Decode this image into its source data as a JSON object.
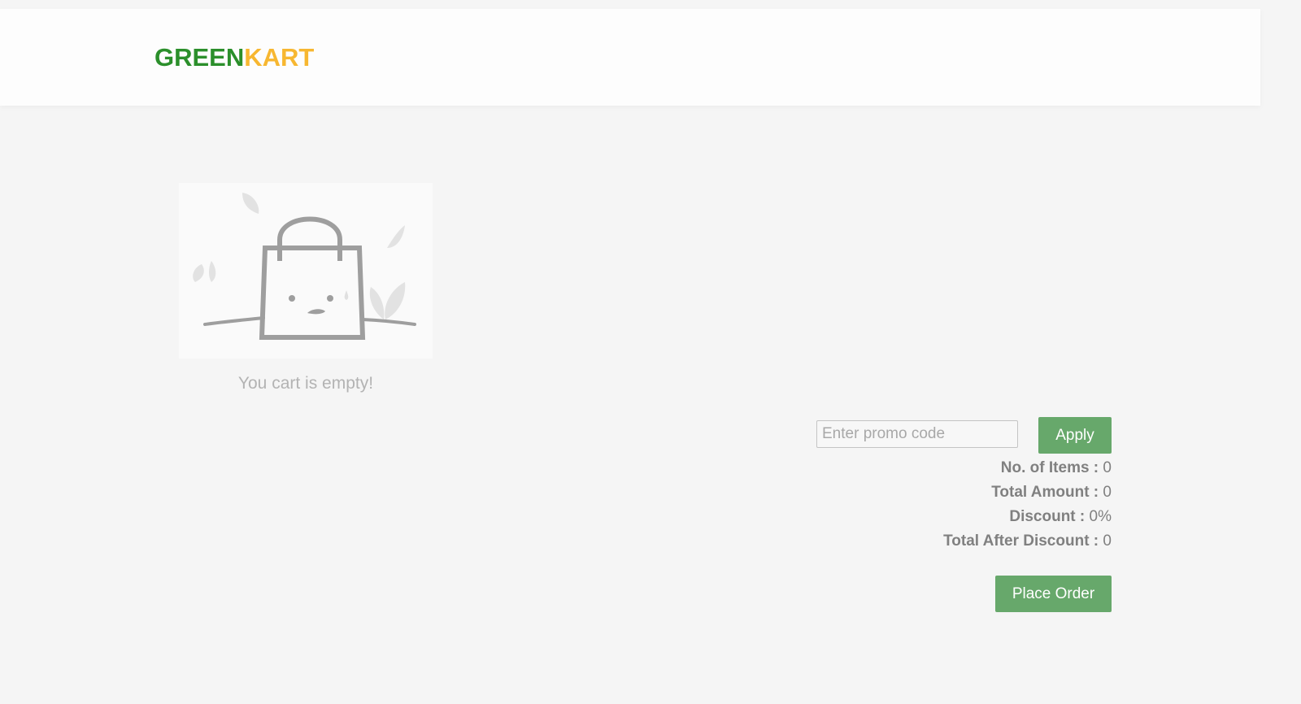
{
  "header": {
    "brand_part1": "GREEN",
    "brand_part2": "KART"
  },
  "cart": {
    "empty_message": "You cart is empty!",
    "illustration_icon": "empty-shopping-bag-icon"
  },
  "promo": {
    "placeholder": "Enter promo code",
    "value": "",
    "apply_label": "Apply"
  },
  "summary": {
    "items_label": "No. of Items :",
    "items_value": "0",
    "amount_label": "Total Amount :",
    "amount_value": "0",
    "discount_label": "Discount :",
    "discount_value": "0%",
    "after_label": "Total After Discount :",
    "after_value": "0"
  },
  "actions": {
    "place_order_label": "Place Order"
  },
  "colors": {
    "brand_green": "#2b8f2b",
    "brand_orange": "#f7b731",
    "button_green": "#67a86b",
    "background": "#f5f5f5"
  }
}
